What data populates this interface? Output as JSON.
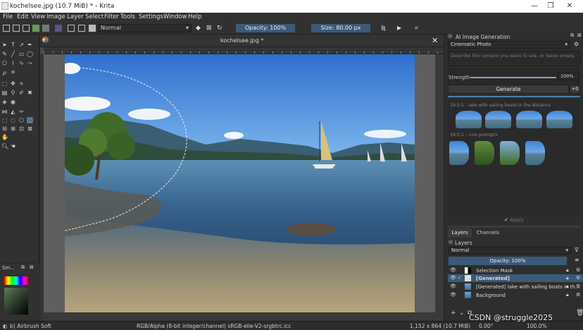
{
  "window": {
    "title": "kochelsee.jpg (10.7 MiB) * - Krita",
    "minimize": "—",
    "maximize": "❐",
    "close": "✕"
  },
  "menu": [
    "File",
    "Edit",
    "View",
    "Image",
    "Layer",
    "Select",
    "Filter",
    "Tools",
    "Settings",
    "Window",
    "Help"
  ],
  "toolbar": {
    "blend_mode": "Normal",
    "opacity_label": "Opacity: 100%",
    "size_label": "Size: 80.00 px"
  },
  "canvas": {
    "tab_title": "kochelsee.jpg *",
    "close": "✕"
  },
  "ai_panel": {
    "title": "AI Image Generation",
    "style": "Cinematic Photo",
    "prompt_placeholder": "Describe the content you want to see, or leave empty.",
    "strength_label": "Strength",
    "strength_value": "100%",
    "strength_fraction": 1.0,
    "generate_label": "Generate",
    "plus_label": "+0",
    "history": [
      {
        "header": "19:5:1 - lake with sailing boats in the distance",
        "count": 4
      },
      {
        "header": "19:5:1 - <no prompt>",
        "count": 4
      }
    ],
    "apply_label": "Apply"
  },
  "layers_panel": {
    "tabs": [
      "Layers",
      "Channels"
    ],
    "title": "Layers",
    "blend_mode": "Normal",
    "opacity_label": "Opacity: 100%",
    "layers": [
      {
        "name": "Selection Mask",
        "kind": "mask"
      },
      {
        "name": "[Generated]",
        "kind": "group",
        "active": true
      },
      {
        "name": "[Generated] lake with sailing boats in th...",
        "kind": "paint"
      },
      {
        "name": "Background",
        "kind": "paint"
      }
    ]
  },
  "small_docker": {
    "title": "Sm..."
  },
  "status": {
    "brush": "b) Airbrush Soft",
    "color_info": "RGB/Alpha (8-bit integer/channel)  sRGB-elle-V2-srgbtrc.icc",
    "dimensions": "1,152 x 864 (10.7 MiB)",
    "rotation": "0.00°",
    "zoom": "100.0%"
  },
  "watermark": "CSDN @struggle2025",
  "colors": {
    "accent": "#3b5a78",
    "panel": "#313131",
    "canvas_bg": "#5f5f5f"
  }
}
